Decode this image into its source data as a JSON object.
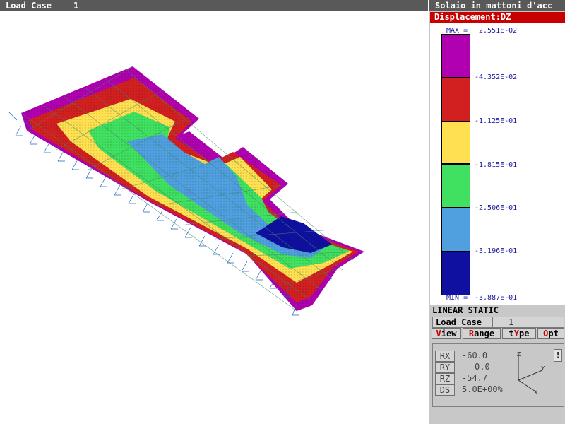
{
  "header": {
    "load_case_label": "Load Case",
    "load_case_number": "1",
    "model_title": "Solaio in mattoni d'acc"
  },
  "legend": {
    "title": "Displacement:DZ",
    "max_label": "MAX =",
    "min_label": "MIN =",
    "labels": [
      "2.551E-02",
      "-4.352E-02",
      "-1.125E-01",
      "-1.815E-01",
      "-2.506E-01",
      "-3.196E-01",
      "-3.887E-01"
    ],
    "colors": [
      "#b000b0",
      "#d22020",
      "#ffe050",
      "#40e060",
      "#50a0e0",
      "#1010a0"
    ]
  },
  "analysis": {
    "type_label": "LINEAR STATIC"
  },
  "load_case_bar": {
    "label": "Load Case",
    "value": "1"
  },
  "menu": {
    "view": {
      "hotkey": "V",
      "rest": "iew"
    },
    "range": {
      "hotkey": "R",
      "rest": "ange"
    },
    "type": {
      "pre": "t",
      "hotkey": "Y",
      "rest": "pe"
    },
    "opt": {
      "hotkey": "O",
      "rest": "pt"
    }
  },
  "rotation": {
    "rx_label": "RX",
    "rx_value": "-60.0",
    "ry_label": "RY",
    "ry_value": "0.0",
    "rz_label": "RZ",
    "rz_value": "-54.7",
    "ds_label": "DS",
    "ds_value": "5.0E+00%",
    "info_icon": "!"
  },
  "triad": {
    "x": "X",
    "y": "Y",
    "z": "Z"
  }
}
